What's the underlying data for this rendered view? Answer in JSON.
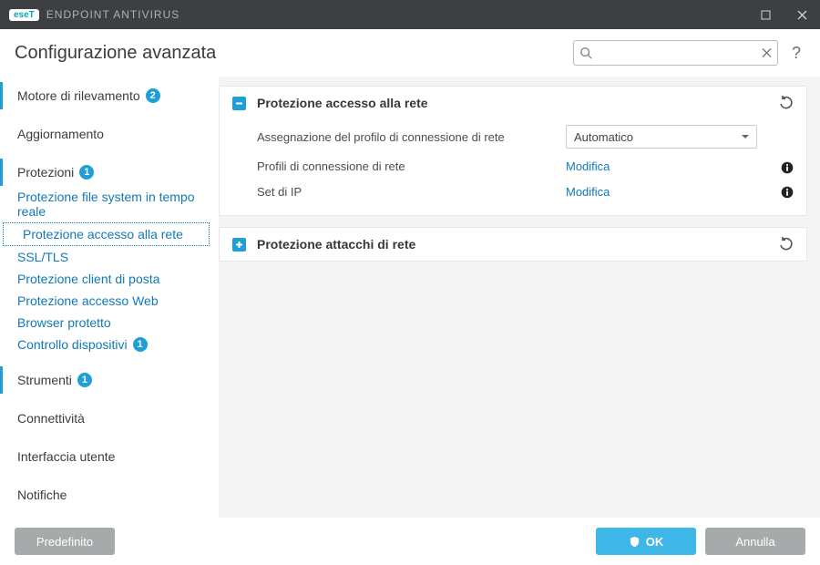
{
  "brand": {
    "logo_text": "eseT",
    "product": "ENDPOINT ANTIVIRUS"
  },
  "window": {
    "maximize_label": "maximize",
    "close_label": "close"
  },
  "header": {
    "title": "Configurazione avanzata",
    "search_placeholder": "",
    "help_label": "?"
  },
  "sidebar": {
    "items": [
      {
        "label": "Motore di rilevamento",
        "badge": "2"
      },
      {
        "label": "Aggiornamento"
      },
      {
        "label": "Protezioni",
        "badge": "1"
      },
      {
        "label": "Protezione file system in tempo reale"
      },
      {
        "label": "Protezione accesso alla rete"
      },
      {
        "label": "SSL/TLS"
      },
      {
        "label": "Protezione client di posta"
      },
      {
        "label": "Protezione accesso Web"
      },
      {
        "label": "Browser protetto"
      },
      {
        "label": "Controllo dispositivi",
        "badge": "1"
      },
      {
        "label": "Strumenti",
        "badge": "1"
      },
      {
        "label": "Connettività"
      },
      {
        "label": "Interfaccia utente"
      },
      {
        "label": "Notifiche"
      }
    ]
  },
  "panels": {
    "net_access": {
      "title": "Protezione accesso alla rete",
      "rows": {
        "profile_assign": {
          "label": "Assegnazione del profilo di connessione di rete",
          "value": "Automatico"
        },
        "conn_profiles": {
          "label": "Profili di connessione di rete",
          "action": "Modifica"
        },
        "ip_sets": {
          "label": "Set di IP",
          "action": "Modifica"
        }
      }
    },
    "net_attack": {
      "title": "Protezione attacchi di rete"
    }
  },
  "footer": {
    "default_btn": "Predefinito",
    "ok_btn": "OK",
    "cancel_btn": "Annulla"
  }
}
